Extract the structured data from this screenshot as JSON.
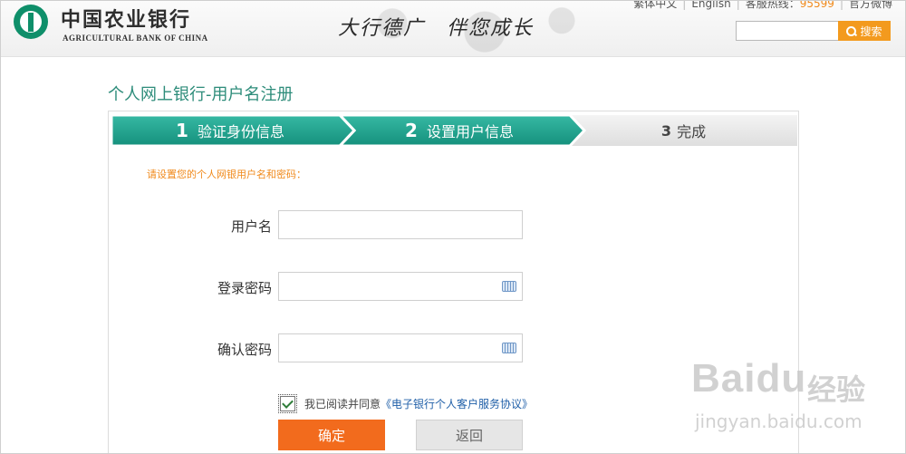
{
  "header": {
    "logo_cn": "中国农业银行",
    "logo_en": "AGRICULTURAL BANK OF CHINA",
    "slogan_part1": "大行德广",
    "slogan_part2": "伴您成长",
    "toplinks": {
      "traditional": "繁体中文",
      "english": "English",
      "hotline_label": "客服热线：",
      "hotline_number": "95599",
      "weibo": "官方微博"
    },
    "search": {
      "value": "",
      "button_label": "搜索"
    }
  },
  "page": {
    "title": "个人网上银行-用户名注册",
    "steps": [
      {
        "num": "1",
        "label": "验证身份信息",
        "state": "done"
      },
      {
        "num": "2",
        "label": "设置用户信息",
        "state": "active"
      },
      {
        "num": "3",
        "label": "完成",
        "state": "pending"
      }
    ],
    "instruction": "请设置您的个人网银用户名和密码：",
    "form": {
      "username_label": "用户名",
      "username_value": "",
      "password_label": "登录密码",
      "password_value": "",
      "confirm_label": "确认密码",
      "confirm_value": ""
    },
    "agreement": {
      "checked": true,
      "text": "我已阅读并同意",
      "link": "《电子银行个人客户服务协议》"
    },
    "buttons": {
      "confirm": "确定",
      "back": "返回"
    }
  },
  "watermark": {
    "brand": "Baidu",
    "cn": "经验",
    "url": "jingyan.baidu.com"
  },
  "colors": {
    "teal": "#1e9e8a",
    "orange": "#f26b1d",
    "link_blue": "#1f5fa8",
    "instruction_orange": "#f08a1c"
  }
}
